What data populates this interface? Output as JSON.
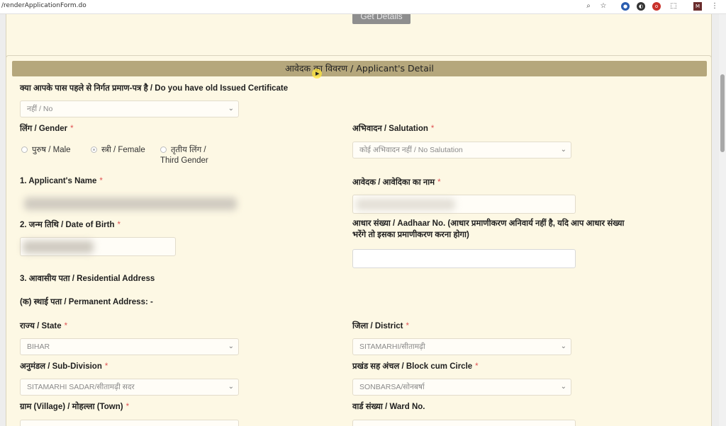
{
  "browser": {
    "url": "/renderApplicationForm.do",
    "icons": [
      "zoom-icon",
      "star-icon",
      "extension-icons",
      "puzzle-icon",
      "profile-icon",
      "menu-icon"
    ]
  },
  "top": {
    "get_details_label": "Get Details"
  },
  "section": {
    "title": "आवेदक का विवरण / Applicant's Detail"
  },
  "form": {
    "old_cert": {
      "label": "क्या आपके पास पहले से निर्गत प्रमाण-पत्र है / Do you have old Issued Certificate",
      "value": "नहीं / No"
    },
    "gender": {
      "label": "लिंग / Gender",
      "required": "*",
      "options": [
        "पुरुष / Male",
        "स्त्री / Female",
        "तृतीय लिंग /",
        "Third Gender"
      ],
      "selected": "स्त्री / Female"
    },
    "salutation": {
      "label": "अभिवादन / Salutation",
      "required": "*",
      "value": "कोई अभिवादन नहीं / No Salutation"
    },
    "applicant_name": {
      "label": "1. Applicant's Name",
      "required": "*"
    },
    "applicant_name_hi": {
      "label": "आवेदक / आवेदिका का नाम",
      "required": "*"
    },
    "dob": {
      "label": "2. जन्म तिथि / Date of Birth",
      "required": "*"
    },
    "aadhaar": {
      "label": "आधार संख्या / Aadhaar No. (आधार प्रमाणीकरण अनिवार्य नहीं है, यदि आप आधार संख्या भरेंगे तो इसका प्रमाणीकरण करना होगा)"
    },
    "address": {
      "label": "3. आवासीय पता / Residential Address"
    },
    "permanent": {
      "label": "(क) स्थाई पता / Permanent Address: -"
    },
    "state": {
      "label": "राज्य / State",
      "required": "*",
      "value": "BIHAR"
    },
    "district": {
      "label": "जिला / District",
      "required": "*",
      "value": "SITAMARHI/सीतामढ़ी"
    },
    "subdivision": {
      "label": "अनुमंडल / Sub-Division",
      "required": "*",
      "value": "SITAMARHI SADAR/सीतामढ़ी सदर"
    },
    "block": {
      "label": "प्रखंड सह अंचल / Block cum Circle",
      "required": "*",
      "value": "SONBARSA/सोनबर्षा"
    },
    "village": {
      "label": "ग्राम (Village) / मोहल्ला (Town)",
      "required": "*"
    },
    "ward": {
      "label": "वार्ड संख्या / Ward No."
    }
  }
}
